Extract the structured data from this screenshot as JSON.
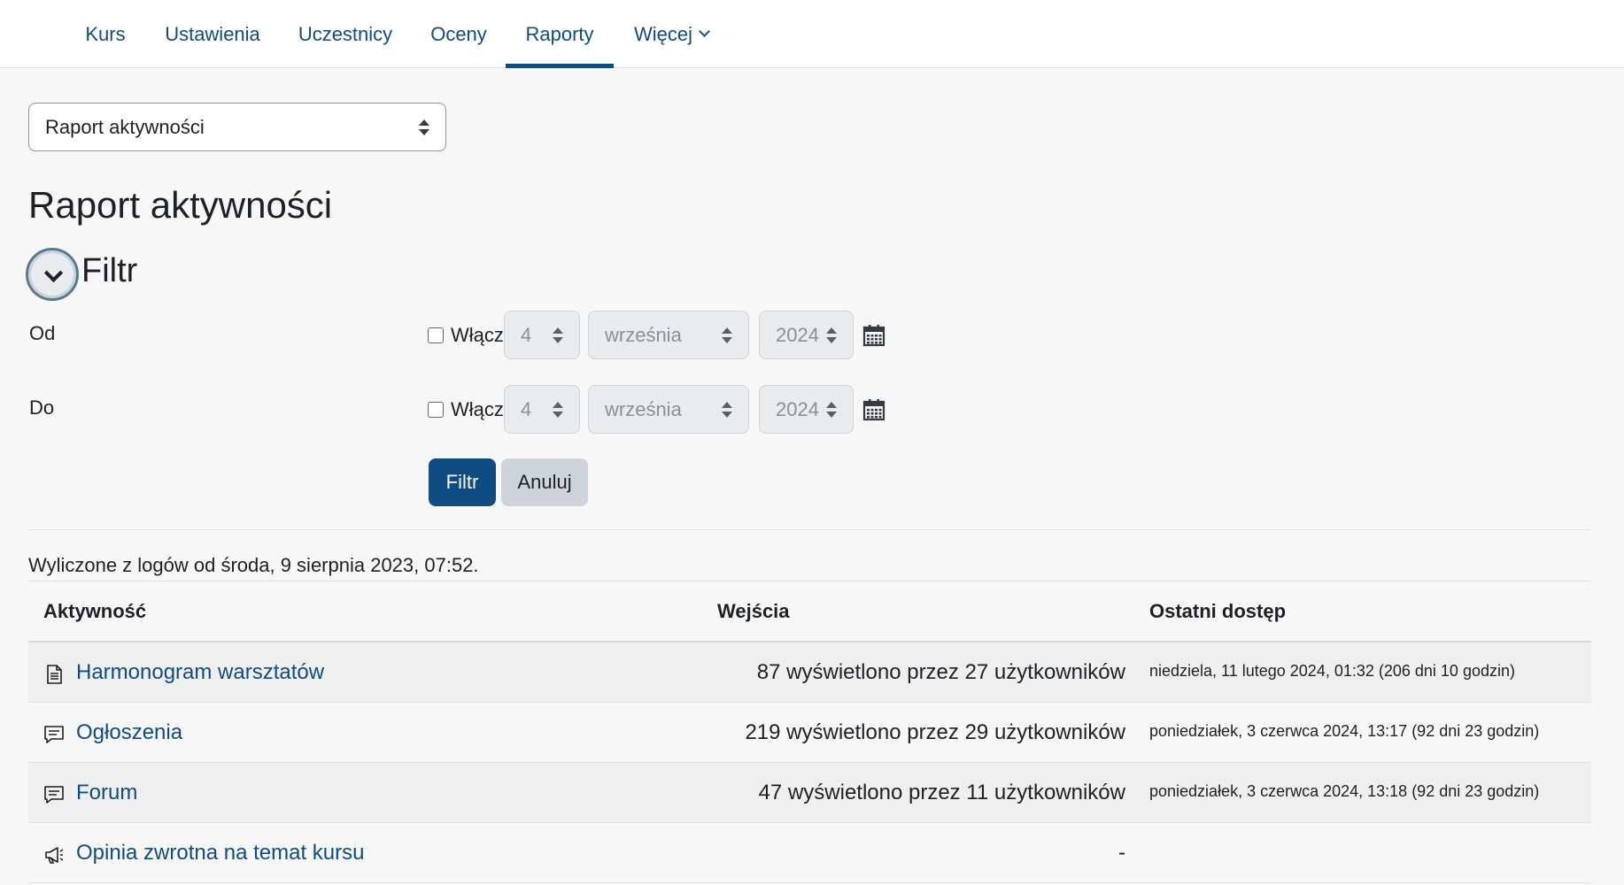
{
  "nav": {
    "tabs": [
      {
        "label": "Kurs"
      },
      {
        "label": "Ustawienia"
      },
      {
        "label": "Uczestnicy"
      },
      {
        "label": "Oceny"
      },
      {
        "label": "Raporty",
        "active": true
      },
      {
        "label": "Więcej"
      }
    ]
  },
  "report_select": {
    "value": "Raport aktywności"
  },
  "page_title": "Raport aktywności",
  "filter": {
    "legend": "Filtr",
    "from": {
      "label": "Od",
      "enable_label": "Włącz",
      "day": "4",
      "month": "września",
      "year": "2024"
    },
    "to": {
      "label": "Do",
      "enable_label": "Włącz",
      "day": "4",
      "month": "września",
      "year": "2024"
    },
    "submit_label": "Filtr",
    "cancel_label": "Anuluj"
  },
  "computed_note": "Wyliczone z logów od środa, 9 sierpnia 2023, 07:52.",
  "table": {
    "headers": {
      "activity": "Aktywność",
      "views": "Wejścia",
      "last_access": "Ostatni dostęp"
    },
    "rows": [
      {
        "icon": "page-icon",
        "name": "Harmonogram warsztatów",
        "views": "87 wyświetlono przez 27 użytkowników",
        "last": "niedziela, 11 lutego 2024, 01:32 (206 dni 10 godzin)"
      },
      {
        "icon": "forum-icon",
        "name": "Ogłoszenia",
        "views": "219 wyświetlono przez 29 użytkowników",
        "last": "poniedziałek, 3 czerwca 2024, 13:17 (92 dni 23 godzin)"
      },
      {
        "icon": "forum-icon",
        "name": "Forum",
        "views": "47 wyświetlono przez 11 użytkowników",
        "last": "poniedziałek, 3 czerwca 2024, 13:18 (92 dni 23 godzin)"
      },
      {
        "icon": "feedback-icon",
        "name": "Opinia zwrotna na temat kursu",
        "views": "-",
        "last": ""
      }
    ]
  },
  "colors": {
    "link": "#0f4c81",
    "primary_button": "#0f4c81",
    "secondary_button": "#ced4da"
  }
}
